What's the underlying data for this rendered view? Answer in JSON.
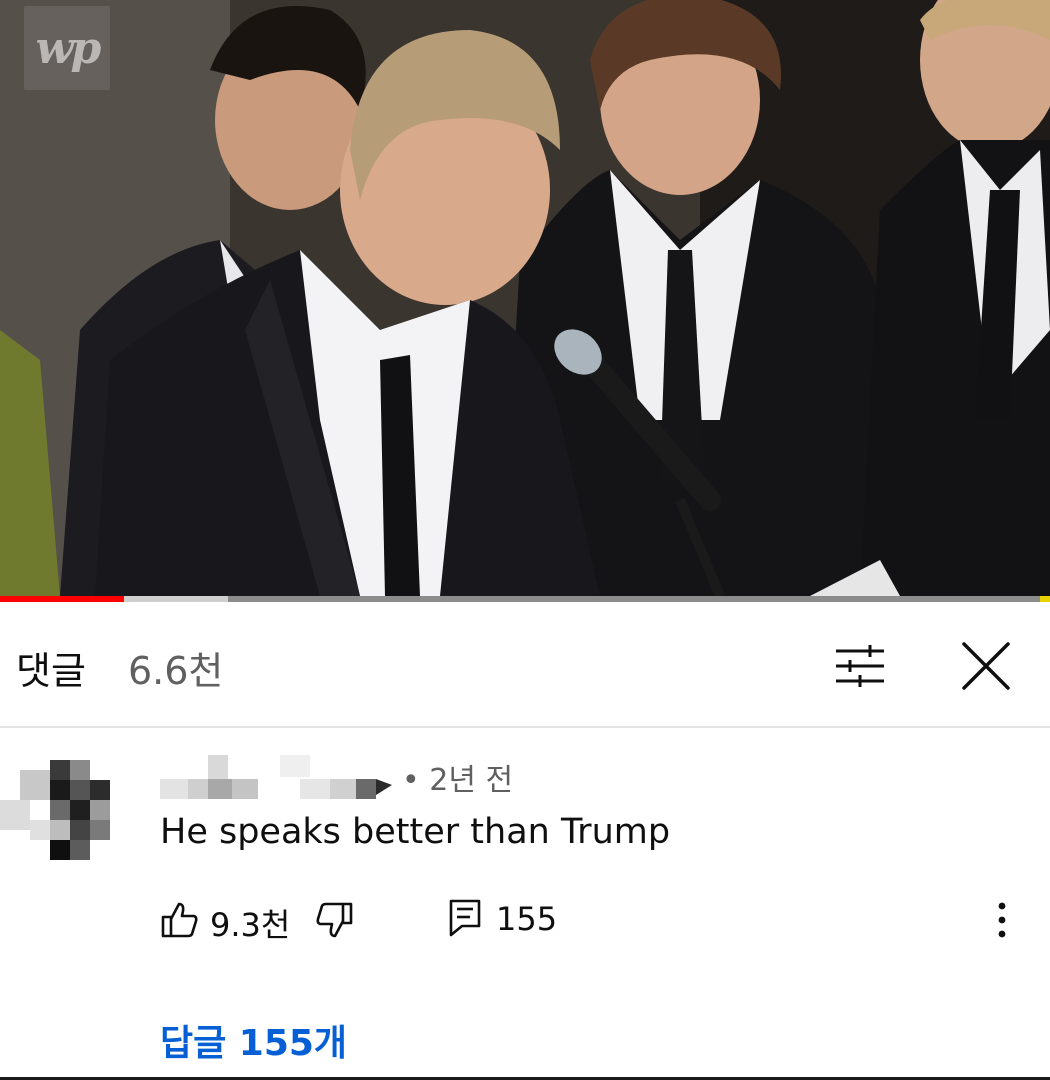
{
  "video": {
    "watermark": "wp",
    "progress_played": 0.118,
    "progress_buffered": 0.217
  },
  "comments_header": {
    "title": "댓글",
    "count": "6.6천",
    "filter_icon": "sliders-icon",
    "close_icon": "close-icon"
  },
  "comment": {
    "timestamp": "• 2년 전",
    "text": "He speaks better than Trump",
    "like_count": "9.3천",
    "reply_count": "155",
    "replies_link": "답글 155개",
    "icons": [
      "thumbs-up-icon",
      "thumbs-down-icon",
      "reply-icon",
      "more-vert-icon"
    ]
  },
  "colors": {
    "accent_red": "#ff0000",
    "link_blue": "#065fd4",
    "secondary_text": "#606060"
  }
}
